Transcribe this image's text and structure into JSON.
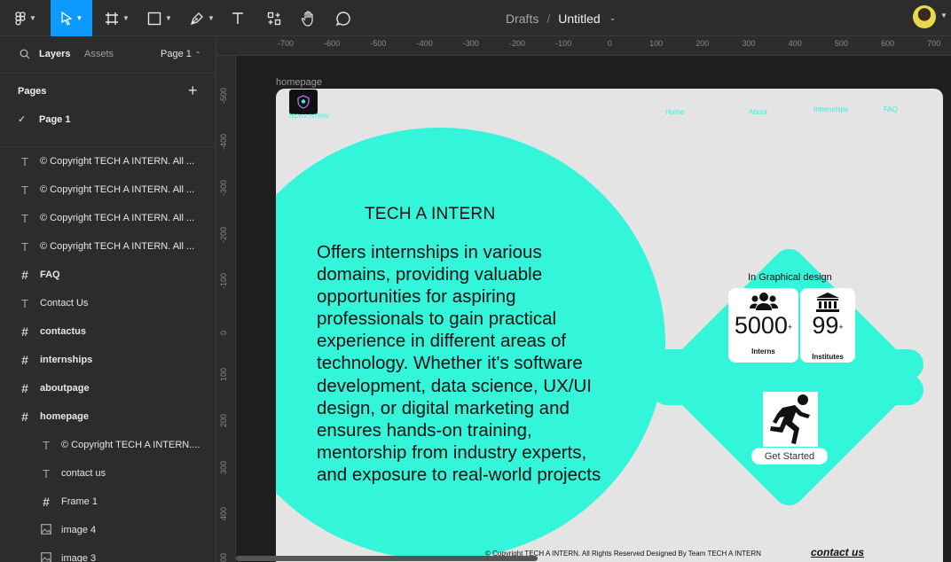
{
  "toolbar": {
    "breadcrumb_drafts": "Drafts",
    "breadcrumb_sep": "/",
    "file_title": "Untitled",
    "icons": [
      "figma-menu-icon",
      "move-tool-icon",
      "frame-tool-icon",
      "shape-tool-icon",
      "pen-tool-icon",
      "text-tool-icon",
      "component-tool-icon",
      "hand-tool-icon",
      "comment-tool-icon"
    ]
  },
  "sidebar": {
    "tab_layers": "Layers",
    "tab_assets": "Assets",
    "page_selector": "Page 1",
    "pages_label": "Pages",
    "current_page": "Page 1",
    "layers": [
      {
        "type": "text",
        "label": "© Copyright TECH A INTERN. All ...",
        "bold": false,
        "indent": 0
      },
      {
        "type": "text",
        "label": "© Copyright TECH A INTERN. All ...",
        "bold": false,
        "indent": 0
      },
      {
        "type": "text",
        "label": "© Copyright TECH A INTERN. All ...",
        "bold": false,
        "indent": 0
      },
      {
        "type": "text",
        "label": "© Copyright TECH A INTERN. All ...",
        "bold": false,
        "indent": 0
      },
      {
        "type": "frame",
        "label": "FAQ",
        "bold": true,
        "indent": 0
      },
      {
        "type": "text",
        "label": "Contact Us",
        "bold": false,
        "indent": 0
      },
      {
        "type": "frame",
        "label": "contactus",
        "bold": true,
        "indent": 0
      },
      {
        "type": "frame",
        "label": "internships",
        "bold": true,
        "indent": 0
      },
      {
        "type": "frame",
        "label": "aboutpage",
        "bold": true,
        "indent": 0
      },
      {
        "type": "frame",
        "label": "homepage",
        "bold": true,
        "indent": 0
      },
      {
        "type": "text",
        "label": "© Copyright TECH A INTERN....",
        "bold": false,
        "indent": 1
      },
      {
        "type": "text",
        "label": "contact us",
        "bold": false,
        "indent": 1
      },
      {
        "type": "frame",
        "label": "Frame 1",
        "bold": false,
        "indent": 1
      },
      {
        "type": "image",
        "label": "image 4",
        "bold": false,
        "indent": 1
      },
      {
        "type": "image",
        "label": "image 3",
        "bold": false,
        "indent": 1
      }
    ]
  },
  "rulers": {
    "top": [
      "-700",
      "-600",
      "-500",
      "-400",
      "-300",
      "-200",
      "-100",
      "0",
      "100",
      "200",
      "300",
      "400",
      "500",
      "600",
      "700"
    ],
    "left": [
      "-500",
      "-400",
      "-300",
      "-200",
      "-100",
      "0",
      "100",
      "200",
      "300",
      "400",
      "500"
    ]
  },
  "frame": {
    "label": "homepage",
    "logo_text": "TECH A INTERN",
    "nav": [
      "Home",
      "About",
      "Internships",
      "FAQ"
    ],
    "hero_title": "TECH A INTERN",
    "hero_desc": "Offers internships in various domains, providing valuable opportunities for aspiring professionals to gain practical experience in different areas of technology. Whether it's software development, data science, UX/UI design, or digital marketing and ensures hands-on training, mentorship from industry experts, and exposure to real-world projects",
    "stats_title": "In Graphical design",
    "stat_interns_value": "5000",
    "stat_interns_suffix": "+",
    "stat_interns_label": "Interns",
    "stat_institutes_value": "99",
    "stat_institutes_suffix": "+",
    "stat_institutes_label": "Institutes",
    "cta_label": "Get Started",
    "footer_copyright": "© Copyright TECH A INTERN. All Rights Reserved Designed By Team TECH A INTERN",
    "footer_contact": "contact us"
  },
  "colors": {
    "accent": "#33f5da",
    "toolbar_active": "#0d99ff",
    "panel": "#2c2c2c",
    "canvas": "#1e1e1e"
  }
}
